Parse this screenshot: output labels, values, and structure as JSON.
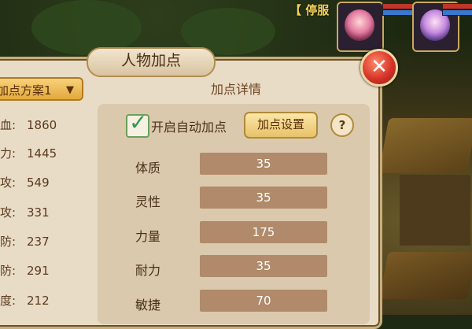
{
  "hud": {
    "status_tag": "【 停服"
  },
  "panel": {
    "title": "人物加点",
    "close_symbol": "✕"
  },
  "scheme_select": {
    "value": "加点方案1"
  },
  "stats": [
    {
      "label": "血:",
      "value": "1860"
    },
    {
      "label": "力:",
      "value": "1445"
    },
    {
      "label": "攻:",
      "value": "549"
    },
    {
      "label": "攻:",
      "value": "331"
    },
    {
      "label": "防:",
      "value": "237"
    },
    {
      "label": "防:",
      "value": "291"
    },
    {
      "label": "度:",
      "value": "212"
    }
  ],
  "details": {
    "title": "加点详情",
    "auto_label": "开启自动加点",
    "auto_checked": true,
    "settings_button": "加点设置",
    "help_button": "?",
    "attributes": [
      {
        "label": "体质",
        "value": "35"
      },
      {
        "label": "灵性",
        "value": "35"
      },
      {
        "label": "力量",
        "value": "175"
      },
      {
        "label": "耐力",
        "value": "35"
      },
      {
        "label": "敏捷",
        "value": "70"
      }
    ]
  },
  "icons": {
    "close": "close-icon",
    "check": "checkmark-icon",
    "chevron": "chevron-down-icon"
  },
  "colors": {
    "panel_bg": "#e9dcc6",
    "button_gold": "#e3a93e",
    "attr_bar": "#b08a6a",
    "close_red": "#d8342a"
  }
}
